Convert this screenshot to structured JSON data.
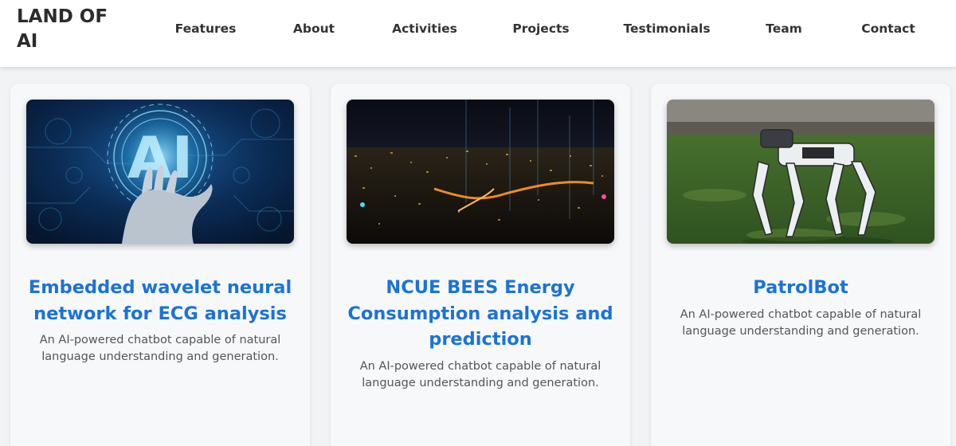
{
  "header": {
    "logo": "LAND OF AI",
    "nav": [
      "Features",
      "About",
      "Activities",
      "Projects",
      "Testimonials",
      "Team",
      "Contact"
    ]
  },
  "cards": [
    {
      "title": "Embedded wavelet neural network for ECG analysis",
      "description": "An AI-powered chatbot capable of natural language understanding and generation.",
      "image": "ai-hand-hologram"
    },
    {
      "title": "NCUE BEES Energy Consumption analysis and prediction",
      "description": "An AI-powered chatbot capable of natural language understanding and generation.",
      "image": "night-city-skyline"
    },
    {
      "title": "PatrolBot",
      "description": "An AI-powered chatbot capable of natural language understanding and generation.",
      "image": "robot-dog-on-grass"
    }
  ],
  "colors": {
    "accent": "#1a73d8",
    "background": "#f1f3f5",
    "card": "#f7f8fa",
    "text": "#333333"
  }
}
